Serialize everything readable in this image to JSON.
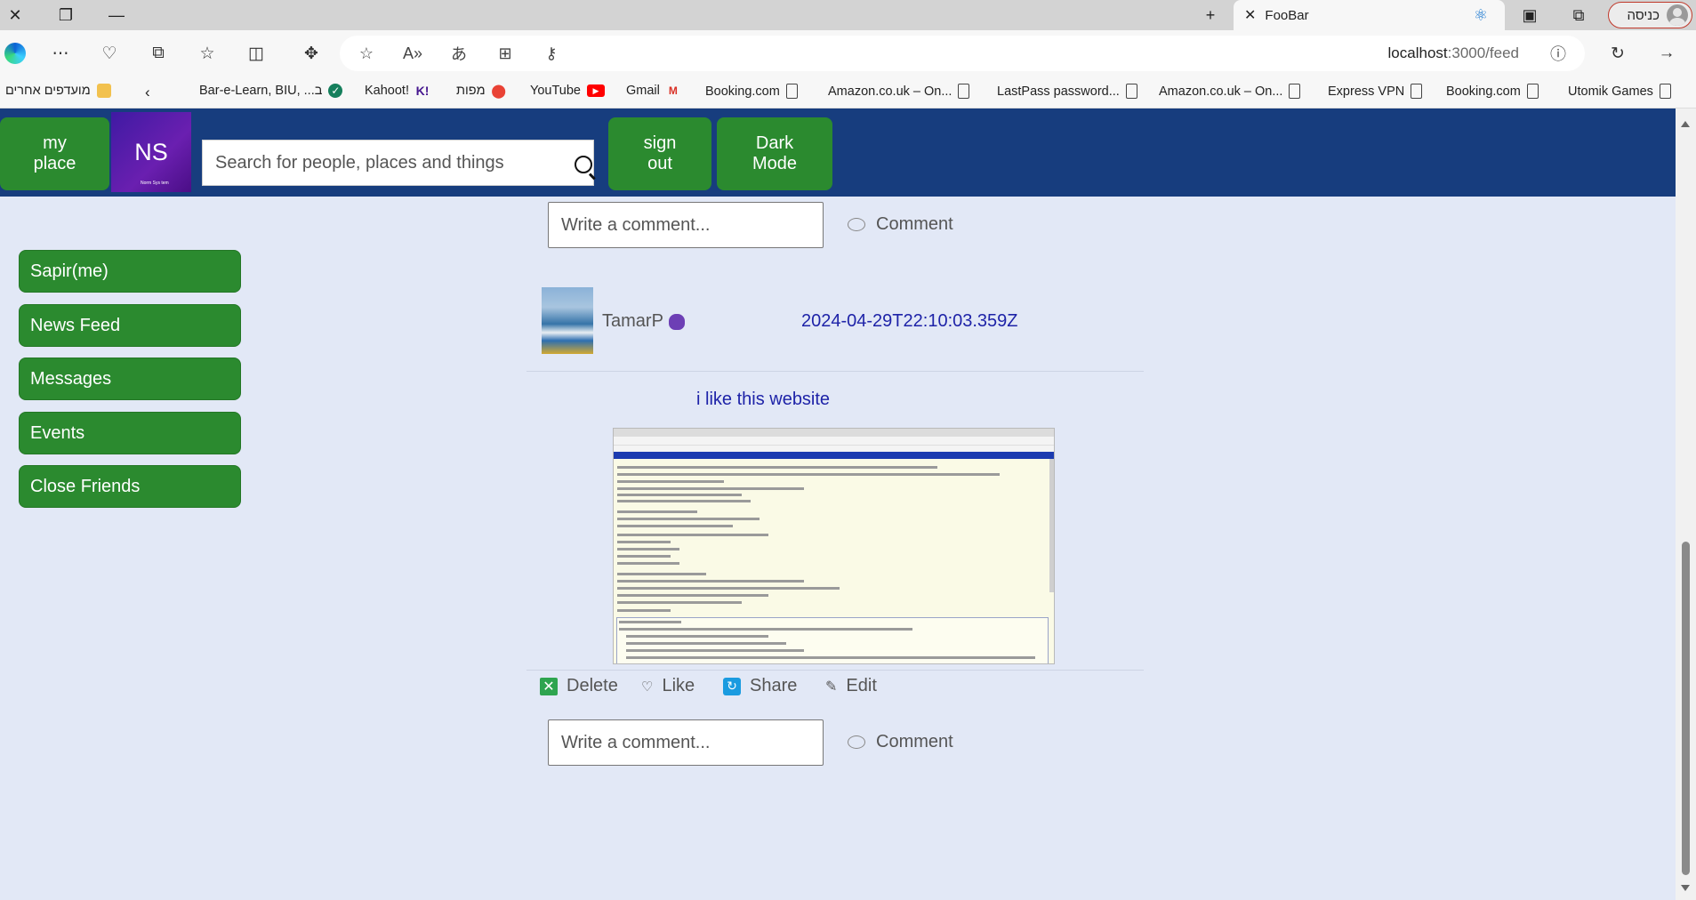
{
  "browser": {
    "tab_title": "FooBar",
    "profile_label": "כניסה",
    "url_host": "localhost",
    "url_rest": ":3000/feed",
    "bookmarks": [
      {
        "label": "מועדפים אחרים"
      },
      {
        "label": "Bar-e-Learn, BIU, ...ב"
      },
      {
        "label": "Kahoot!"
      },
      {
        "label": "מפות"
      },
      {
        "label": "YouTube"
      },
      {
        "label": "Gmail"
      },
      {
        "label": "Booking.com"
      },
      {
        "label": "Amazon.co.uk – On..."
      },
      {
        "label": "LastPass password..."
      },
      {
        "label": "Amazon.co.uk – On..."
      },
      {
        "label": "Express VPN"
      },
      {
        "label": "Booking.com"
      },
      {
        "label": "Utomik Games"
      }
    ]
  },
  "header": {
    "my_place": "my place",
    "ns": "NS",
    "ns_sub": "Norm Sys tem",
    "search_placeholder": "Search for people, places and things",
    "sign_out": "sign out",
    "dark_mode": "Dark Mode"
  },
  "sidebar": {
    "items": [
      {
        "label": "Sapir(me)"
      },
      {
        "label": "News Feed"
      },
      {
        "label": "Messages"
      },
      {
        "label": "Events"
      },
      {
        "label": "Close Friends"
      }
    ]
  },
  "feed": {
    "comment_placeholder": "Write a comment...",
    "comment_label": "Comment",
    "post": {
      "author": "TamarP",
      "timestamp": "2024-04-29T22:10:03.359Z",
      "text": "i like this website",
      "actions": {
        "delete": "Delete",
        "like": "Like",
        "share": "Share",
        "edit": "Edit"
      }
    }
  },
  "colors": {
    "appbar": "#173d7e",
    "button_green": "#2b8a2f",
    "page_bg": "#e2e8f6",
    "link_blue": "#1e23a8"
  }
}
